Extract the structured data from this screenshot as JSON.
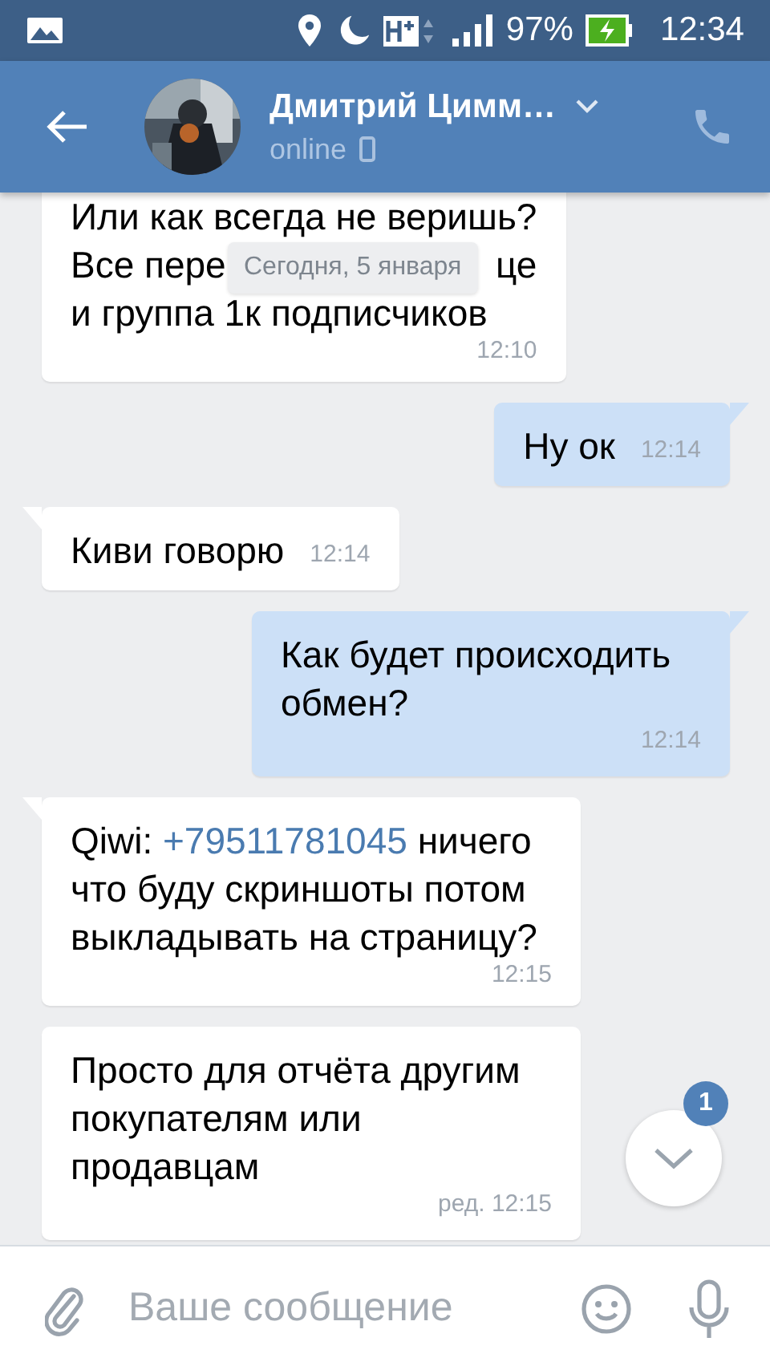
{
  "status_bar": {
    "battery": "97%",
    "time": "12:34"
  },
  "header": {
    "name": "Дмитрий Цимм…",
    "status": "online"
  },
  "date_divider": "Сегодня, 5 января",
  "messages": [
    {
      "kind": "lines",
      "outgoing": false,
      "lines": [
        [
          "Или как всегда не веришь?"
        ],
        [
          "Все пере",
          "це"
        ],
        [
          "и группа 1к подписчиков"
        ]
      ],
      "time": "12:10"
    },
    {
      "kind": "text",
      "outgoing": true,
      "tail": true,
      "text": "Ну ок",
      "time": "12:14"
    },
    {
      "kind": "text",
      "outgoing": false,
      "tail": true,
      "text": "Киви говорю",
      "time": "12:14"
    },
    {
      "kind": "text",
      "outgoing": true,
      "tail": true,
      "text": "Как будет происходить обмен?",
      "time": "12:14"
    },
    {
      "kind": "link",
      "outgoing": false,
      "tail": true,
      "before": "Qiwi: ",
      "link": "+79511781045",
      "after": " ничего что буду скриншоты потом выкладывать на страницу?",
      "time": "12:15"
    },
    {
      "kind": "text",
      "outgoing": false,
      "tail": false,
      "text": "Просто для отчёта другим покупателям или продавцам",
      "time": "ред. 12:15"
    }
  ],
  "scroll_button": {
    "badge": "1"
  },
  "composer": {
    "placeholder": "Ваше сообщение"
  }
}
